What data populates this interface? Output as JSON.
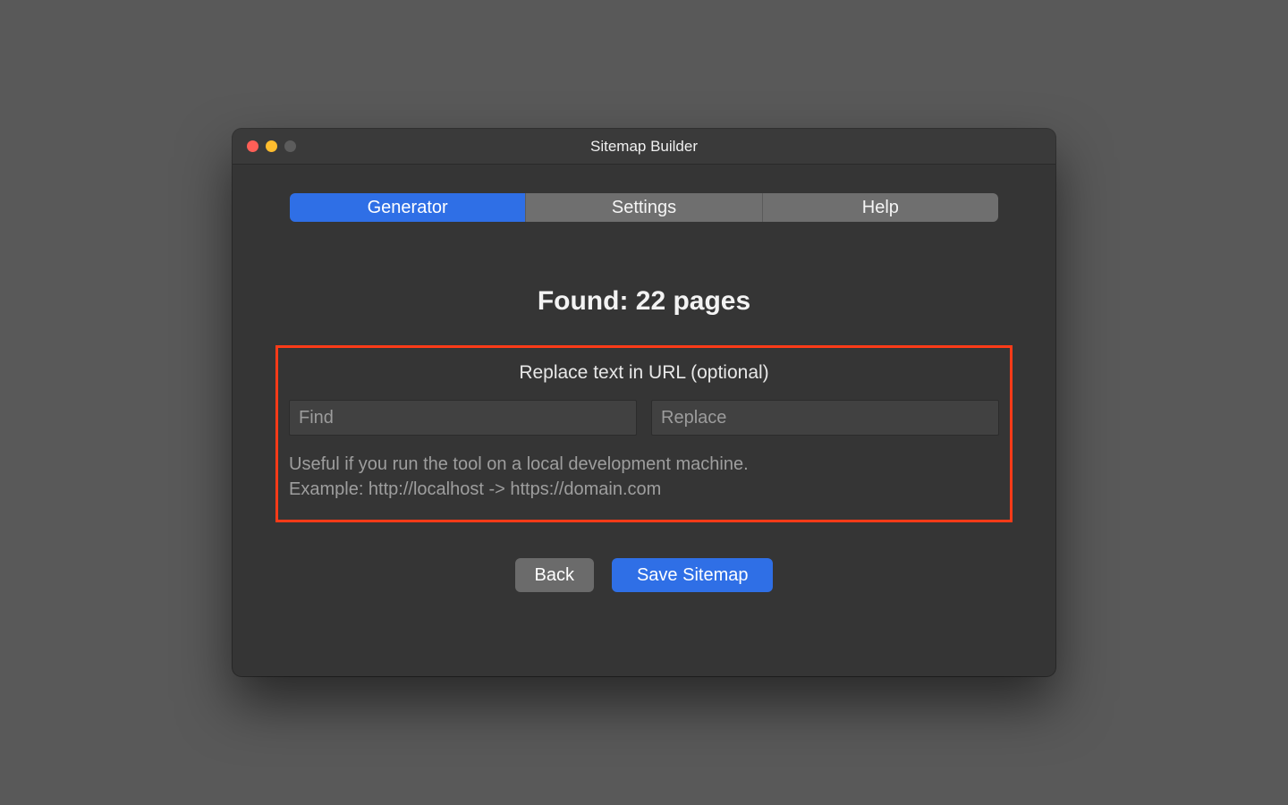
{
  "window": {
    "title": "Sitemap Builder"
  },
  "tabs": {
    "generator": "Generator",
    "settings": "Settings",
    "help": "Help",
    "active": "generator"
  },
  "main": {
    "found_label": "Found: 22 pages",
    "replace_section_label": "Replace text in URL (optional)",
    "find_placeholder": "Find",
    "replace_placeholder": "Replace",
    "help_line1": "Useful if you run the tool on a local development machine.",
    "help_line2": "Example: http://localhost -> https://domain.com"
  },
  "buttons": {
    "back": "Back",
    "save": "Save Sitemap"
  },
  "highlight_color": "#ff3b18"
}
